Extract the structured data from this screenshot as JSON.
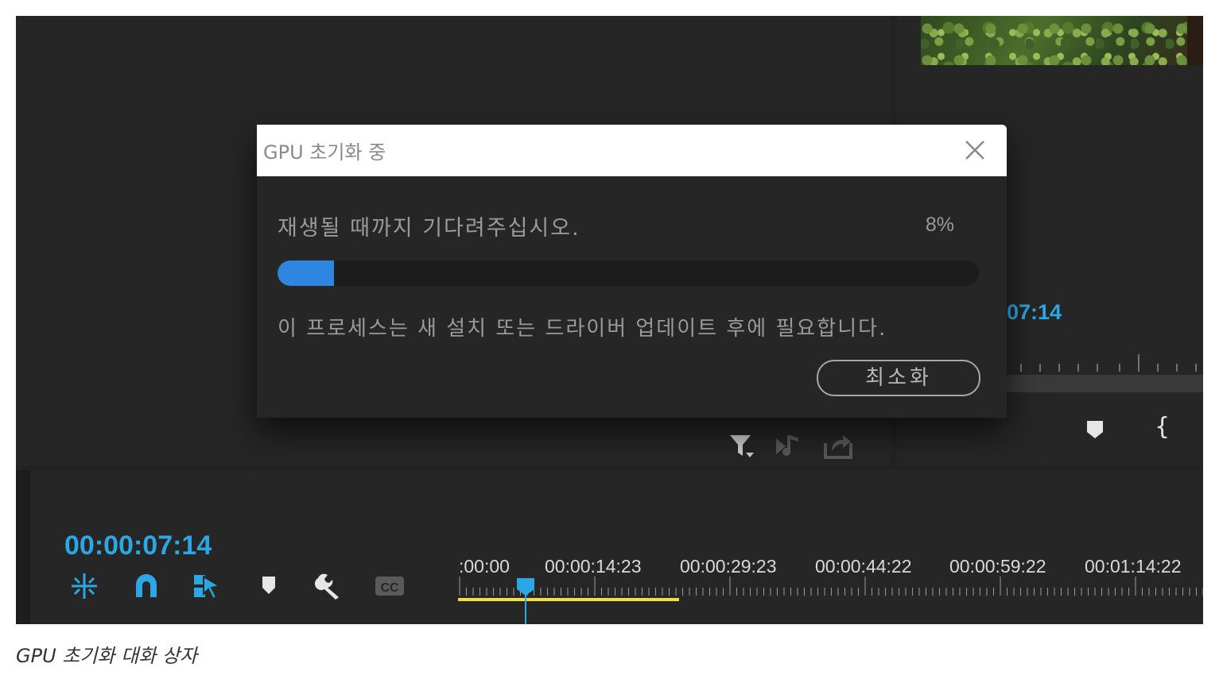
{
  "dialog": {
    "title": "GPU 초기화 중",
    "message": "재생될 때까지 기다려주십시오.",
    "progress_percent": 8,
    "progress_label": "8%",
    "info": "이 프로세스는 새 설치 또는 드라이버 업데이트 후에 필요합니다.",
    "minimize_label": "최소화"
  },
  "program_monitor": {
    "timecode": "07:14"
  },
  "timeline": {
    "timecode": "00:00:07:14",
    "ruler_labels": [
      ":00:00",
      "00:00:14:23",
      "00:00:29:23",
      "00:00:44:22",
      "00:00:59:22",
      "00:01:14:22"
    ],
    "tools": [
      "insert-nested-icon",
      "snap-magnet-icon",
      "linked-selection-icon",
      "add-marker-icon",
      "wrench-settings-icon",
      "captions-cc-icon"
    ]
  },
  "source_toolbar": {
    "icons": [
      "filter-icon",
      "audio-output-icon",
      "export-frame-icon"
    ]
  },
  "colors": {
    "accent_blue": "#2aa8e6",
    "progress_blue": "#2f86e0",
    "work_area_yellow": "#f0e040",
    "panel_bg": "#262626"
  },
  "caption": "GPU 초기화 대화 상자"
}
